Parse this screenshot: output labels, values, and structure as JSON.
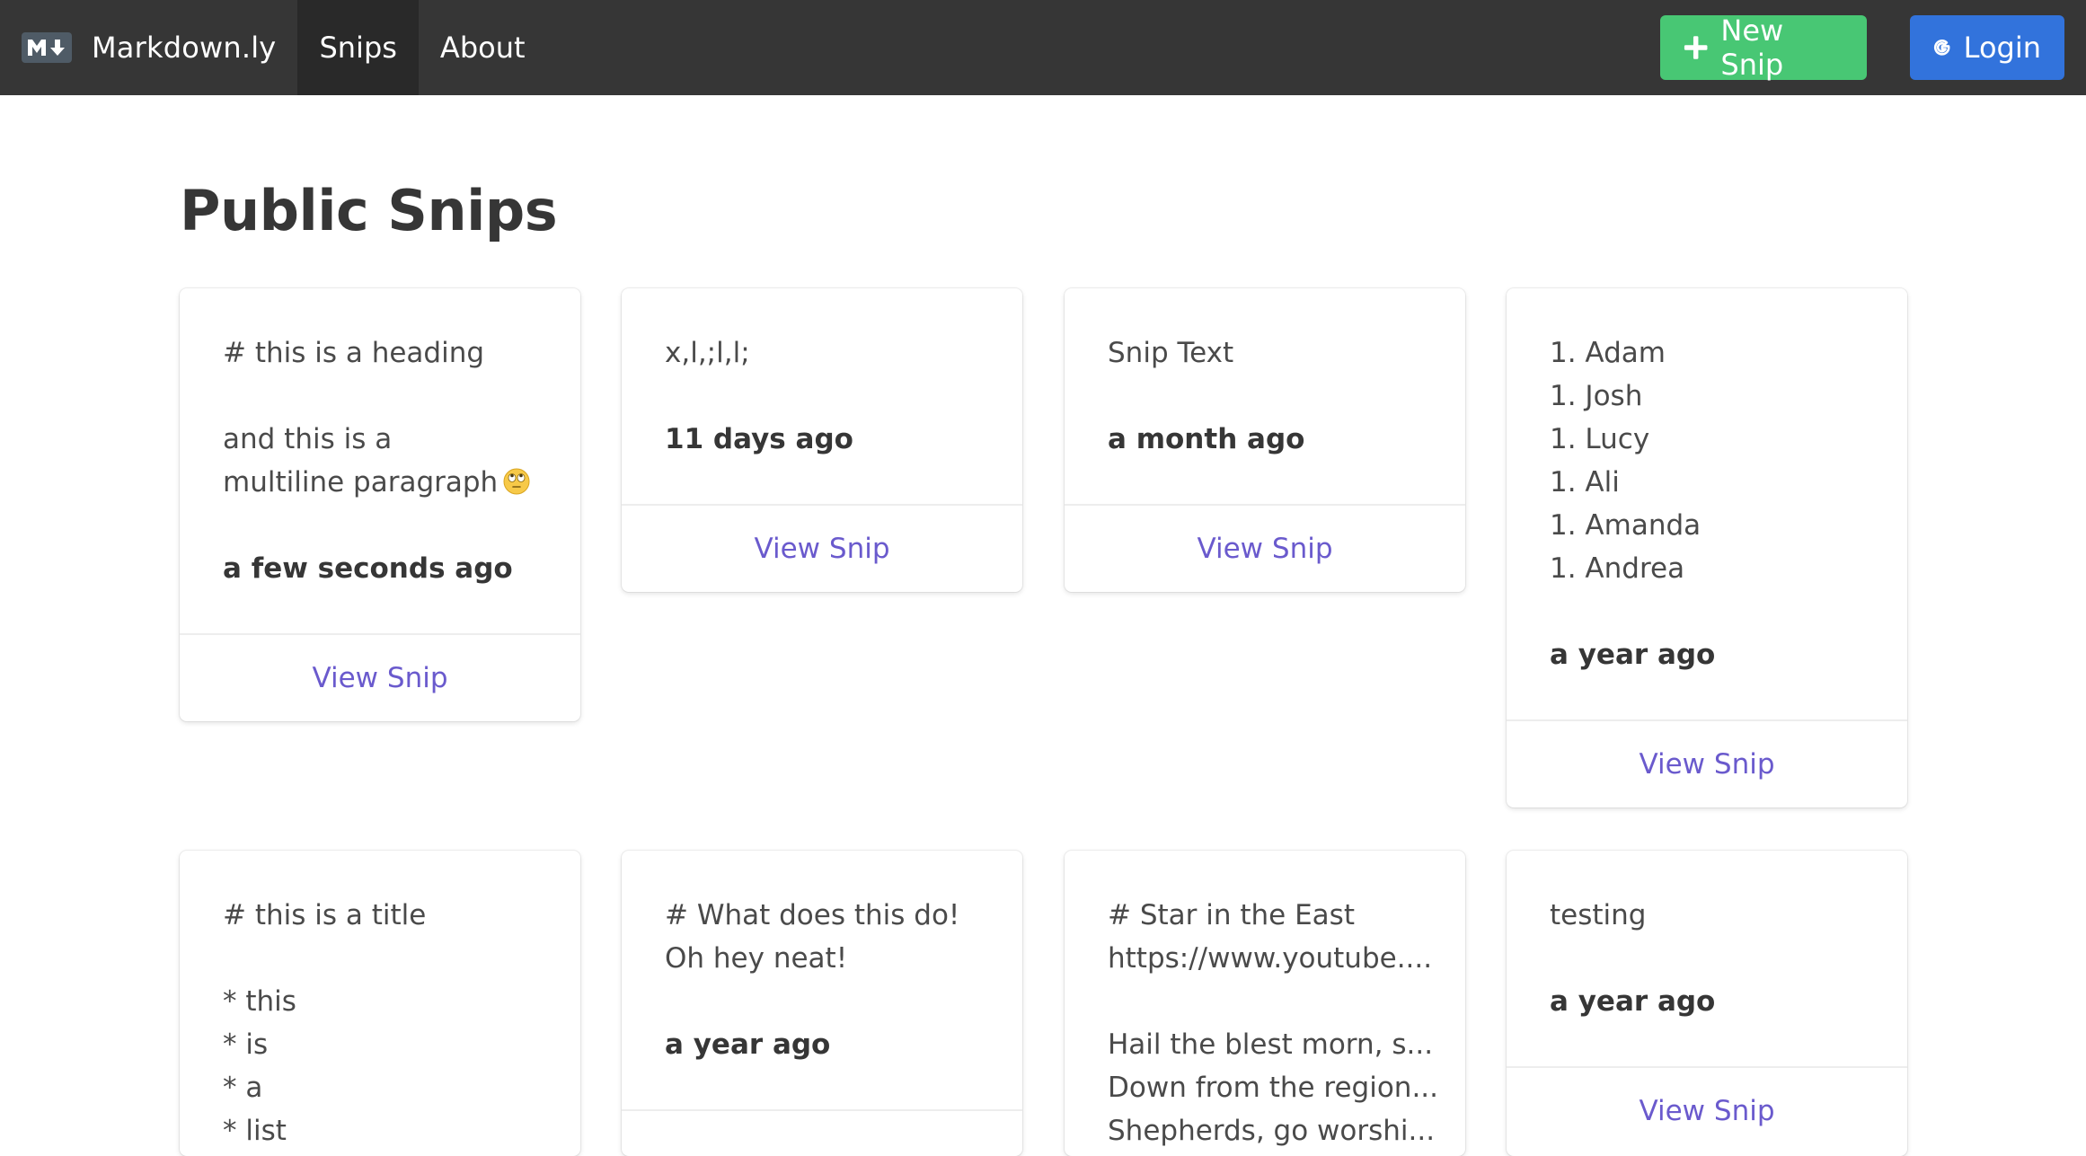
{
  "navbar": {
    "brand": "Markdown.ly",
    "items": [
      {
        "label": "Snips",
        "active": true
      },
      {
        "label": "About",
        "active": false
      }
    ],
    "new_snip_label": "New Snip",
    "login_label": "Login",
    "colors": {
      "navbar_bg": "#363636",
      "new_snip_bg": "#48c774",
      "login_bg": "#3273dc"
    }
  },
  "main": {
    "title": "Public Snips",
    "link_color": "#6a5acd",
    "cards": [
      {
        "lines": [
          "# this is a heading",
          "",
          "and this is a",
          "multiline paragraph"
        ],
        "emoji": "face-with-rolling-eyes",
        "time": "a few seconds ago",
        "link": "View Snip"
      },
      {
        "lines": [
          "x,l,;l,l;"
        ],
        "time": "11 days ago",
        "link": "View Snip"
      },
      {
        "lines": [
          "Snip Text"
        ],
        "time": "a month ago",
        "link": "View Snip"
      },
      {
        "lines": [
          "1. Adam",
          "1. Josh",
          "1. Lucy",
          "1. Ali",
          "1. Amanda",
          "1. Andrea"
        ],
        "time": "a year ago",
        "link": "View Snip"
      },
      {
        "lines": [
          "# this is a title",
          "",
          "* this",
          "* is",
          "* a",
          "* list"
        ],
        "time": "",
        "link": ""
      },
      {
        "lines": [
          "# What does this do!",
          "Oh hey neat!"
        ],
        "time": "a year ago",
        "link": ""
      },
      {
        "lines": [
          "# Star in the East",
          "https://www.youtube....",
          "",
          "Hail the blest morn, s...",
          "Down from the region...",
          "Shepherds, go worshi..."
        ],
        "time": "",
        "link": ""
      },
      {
        "lines": [
          "testing"
        ],
        "time": "a year ago",
        "link": "View Snip"
      }
    ]
  }
}
